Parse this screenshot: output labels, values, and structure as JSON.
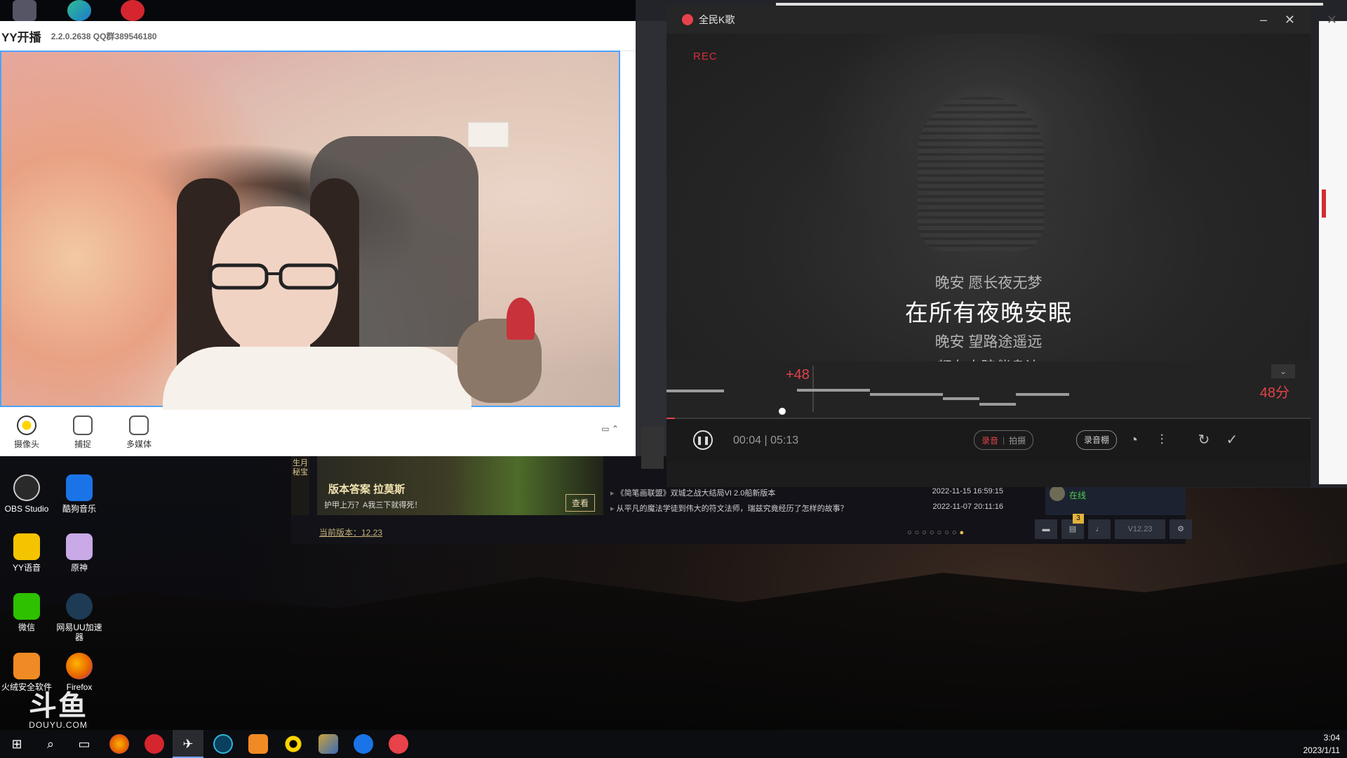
{
  "yy": {
    "title": "YY开播",
    "version": "2.2.0.2638 QQ群389546180",
    "tools": [
      "摄像头",
      "捕捉",
      "多媒体"
    ]
  },
  "desktop_icons": [
    {
      "label": "OBS Studio",
      "icon": "obs-icon",
      "color": "#2a2a2a"
    },
    {
      "label": "酷狗音乐",
      "icon": "kugou-icon",
      "color": "#1a74e8"
    },
    {
      "label": "YY语音",
      "icon": "yy-voice-icon",
      "color": "#f5c400"
    },
    {
      "label": "原神",
      "icon": "genshin-icon",
      "color": "#c9a9e6"
    },
    {
      "label": "微信",
      "icon": "wechat-icon",
      "color": "#2dc100"
    },
    {
      "label": "网易UU加速器",
      "icon": "uu-icon",
      "color": "#1d3b55"
    },
    {
      "label": "火绒安全软件",
      "icon": "huorong-icon",
      "color": "#f08a24"
    },
    {
      "label": "Firefox",
      "icon": "firefox-icon",
      "color": "#e66000"
    }
  ],
  "douyu": {
    "logo": "斗鱼",
    "sub": "DOUYU.COM"
  },
  "launcher": {
    "side_label": "生月秘宝",
    "banner_title": "版本答案 拉莫斯",
    "banner_sub": "护甲上万？A我三下就得死！",
    "banner_button": "查看",
    "current_version": "当前版本：12.23",
    "news": [
      {
        "text": "《简笔画联盟》双城之战大结局VI 2.0船新版本",
        "date": "2022-11-15 16:59:15"
      },
      {
        "text": "从平凡的魔法学徒到伟大的符文法师，瑞兹究竟经历了怎样的故事？",
        "date": "2022-11-07 20:11:16"
      }
    ],
    "friend_status": "在线",
    "badge_count": "3",
    "client_version": "V12.23"
  },
  "karaoke": {
    "title": "全民K歌",
    "rec": "REC",
    "lyrics": {
      "prev": "晚安 愿长夜无梦",
      "current": "在所有夜晚安眠",
      "next1": "晚安 望路途遥远",
      "next2": "都有人陪伴身边"
    },
    "bonus": "+48",
    "score": "48分",
    "time_current": "00:04",
    "time_total": "05:13",
    "record_audio": "录音",
    "record_video": "拍摄",
    "studio": "录音棚",
    "progress": 0.013
  },
  "taskbar": {
    "time": "3:04",
    "date": "2023/1/11"
  }
}
